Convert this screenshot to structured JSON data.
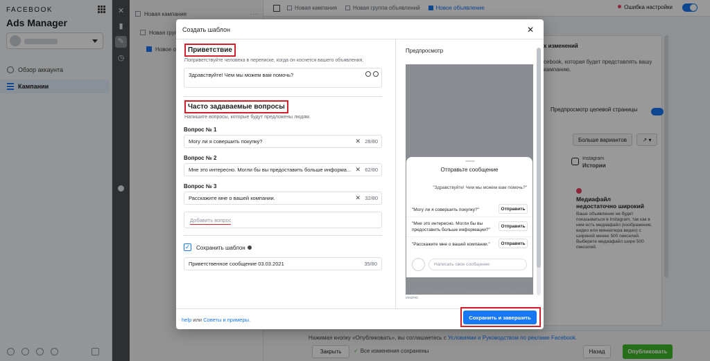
{
  "app": {
    "brand_small": "FACEBOOK",
    "brand_big": "Ads Manager"
  },
  "nav": {
    "overview": "Обзор аккаунта",
    "campaigns": "Кампании"
  },
  "tree": {
    "campaign": "Новая кампания",
    "adset": "Новая груп",
    "ad": "Новое об"
  },
  "topbar": {
    "crumbs": [
      "Новая кампания",
      "Новая группа объявлений",
      "Новое объявление"
    ],
    "error_label": "Ошибка настройки"
  },
  "right_panel": {
    "changes_title": "х изменений",
    "changes_text_1": "cebook, которая будет представлять вашу",
    "changes_text_2": "кампанию.",
    "preview_tab": "Предпросмотр целевой страницы",
    "more_options": "Больше вариантов",
    "instagram_label": "Instagram",
    "stories_label": "Истории",
    "warning_title": "Медиафайл недостаточно широкий",
    "warning_body": "Ваше объявление не будет показываться в Instagram, так как в нем есть медиафайл (изображение, видео или миниатюра видео) с шириной менее 500 пикселей. Выберите медиафайл шире 500 пикселей."
  },
  "footer": {
    "agree_prefix": "Нажимая кнопку «Опубликовать», вы соглашаетесь с",
    "agree_link": "Условиями и Руководством по рекламе Facebook.",
    "close": "Закрыть",
    "saved": "Все изменения сохранены",
    "back": "Назад",
    "publish": "Опубликовать"
  },
  "modal": {
    "title": "Создать шаблон",
    "greeting": {
      "title": "Приветствие",
      "description": "Поприветствуйте человека в переписке, когда он коснется вашего объявления.",
      "value": "Здравствуйте! Чем мы можем вам помочь?"
    },
    "faq": {
      "title": "Часто задаваемые вопросы",
      "description": "Напишите вопросы, которые будут предложены людям.",
      "questions": [
        {
          "label": "Вопрос № 1",
          "value": "Могу ли я совершить покупку?",
          "count": "28/80"
        },
        {
          "label": "Вопрос № 2",
          "value": "Мне это интересно. Могли бы вы предоставить больше информа...",
          "count": "62/80"
        },
        {
          "label": "Вопрос № 3",
          "value": "Расскажите мне о вашей компании.",
          "count": "32/80"
        }
      ],
      "add_question": "Добавить вопрос"
    },
    "save_template_label": "Сохранить шаблон",
    "template_name": "Приветственное сообщение 03.03.2021",
    "template_name_count": "35/80",
    "help_link": "help",
    "help_or": "или",
    "tips_link": "Советы и примеры.",
    "save_button": "Сохранить и завершить"
  },
  "preview": {
    "title": "Предпросмотр",
    "sheet_title": "Отправьте сообщение",
    "greeting": "\"Здравствуйте! Чем мы можем вам помочь?\"",
    "questions": [
      "\"Могу ли я совершить покупку?\"",
      "\"Мне это интересно. Могли бы вы предоставить больше информации?\"",
      "\"Расскажите мне о вашей компании.\""
    ],
    "send_label": "Отправить",
    "message_placeholder": "Написать свое сообщение",
    "note": "На других устройствах это сообщение может выглядеть иначе."
  }
}
